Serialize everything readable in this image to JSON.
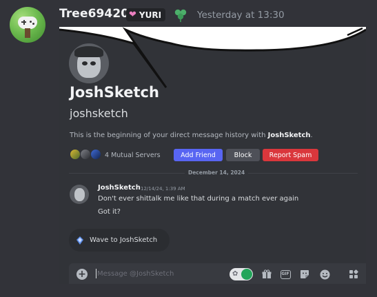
{
  "message": {
    "author": "Tree69420",
    "tag": {
      "label": "YURI",
      "icon": "heart-icon"
    },
    "decoration_icon": "green-heart-clover-icon",
    "timestamp": "Yesterday at 13:30"
  },
  "screenshot": {
    "dm": {
      "display_name": "JoshSketch",
      "username": "joshsketch",
      "intro_prefix": "This is the beginning of your direct message history with ",
      "intro_name": "JoshSketch",
      "intro_suffix": ".",
      "mutual_servers": "4 Mutual Servers",
      "buttons": {
        "add_friend": "Add Friend",
        "block": "Block",
        "report_spam": "Report Spam"
      }
    },
    "date_divider": "December 14, 2024",
    "messages": [
      {
        "author": "JoshSketch",
        "time": "12/14/24, 1:39 AM",
        "lines": [
          "Don't ever shittalk me like that during a match ever again",
          "Got it?"
        ]
      }
    ],
    "wave_button": "Wave to JoshSketch",
    "composer": {
      "placeholder": "Message @JoshSketch",
      "tools": [
        "gift-icon",
        "gif-icon",
        "sticker-icon",
        "emoji-icon",
        "apps-icon"
      ]
    }
  },
  "colors": {
    "background": "#323339",
    "brand": "#5865f2",
    "danger": "#da373c",
    "secondary": "#4e5058",
    "tag_heart": "#eb7fc0"
  }
}
